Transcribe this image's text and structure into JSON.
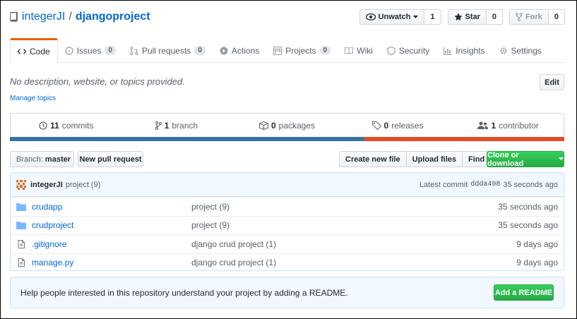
{
  "repo": {
    "owner": "integerJI",
    "separator": "/",
    "name": "djangoproject"
  },
  "actions": {
    "watch": {
      "label": "Unwatch",
      "count": "1"
    },
    "star": {
      "label": "Star",
      "count": "0"
    },
    "fork": {
      "label": "Fork",
      "count": "0"
    }
  },
  "tabs": [
    {
      "label": "Code",
      "count": null
    },
    {
      "label": "Issues",
      "count": "0"
    },
    {
      "label": "Pull requests",
      "count": "0"
    },
    {
      "label": "Actions",
      "count": null
    },
    {
      "label": "Projects",
      "count": "0"
    },
    {
      "label": "Wiki",
      "count": null
    },
    {
      "label": "Security",
      "count": null
    },
    {
      "label": "Insights",
      "count": null
    },
    {
      "label": "Settings",
      "count": null
    }
  ],
  "about": {
    "description": "No description, website, or topics provided.",
    "manage_topics": "Manage topics",
    "edit": "Edit"
  },
  "summary": {
    "commits": {
      "num": "11",
      "label": "commits"
    },
    "branch": {
      "num": "1",
      "label": "branch"
    },
    "packages": {
      "num": "0",
      "label": "packages"
    },
    "releases": {
      "num": "0",
      "label": "releases"
    },
    "contributor": {
      "num": "1",
      "label": "contributor"
    }
  },
  "language_bar": {
    "python_fraction": 0.64,
    "colors": {
      "python": "#3572A5",
      "html": "#e34c26"
    }
  },
  "file_nav": {
    "branch_key": "Branch:",
    "branch_value": "master",
    "new_pr": "New pull request",
    "create_file": "Create new file",
    "upload_files": "Upload files",
    "find_file": "Find file",
    "clone": "Clone or download"
  },
  "commit_tease": {
    "author": "integerJI",
    "message": "project (9)",
    "latest_label": "Latest commit",
    "sha": "ddda498",
    "age": "35 seconds ago"
  },
  "files": [
    {
      "type": "dir",
      "name": "crudapp",
      "message": "project (9)",
      "age": "35 seconds ago"
    },
    {
      "type": "dir",
      "name": "crudproject",
      "message": "project (9)",
      "age": "35 seconds ago"
    },
    {
      "type": "file",
      "name": ".gitignore",
      "message": "django crud project (1)",
      "age": "9 days ago"
    },
    {
      "type": "file",
      "name": "manage.py",
      "message": "django crud project (1)",
      "age": "9 days ago"
    }
  ],
  "readme_prompt": {
    "text": "Help people interested in this repository understand your project by adding a README.",
    "button": "Add a README"
  },
  "colors": {
    "link": "#0366d6",
    "accent_tab": "#e36209",
    "primary_green": "#28a745"
  }
}
